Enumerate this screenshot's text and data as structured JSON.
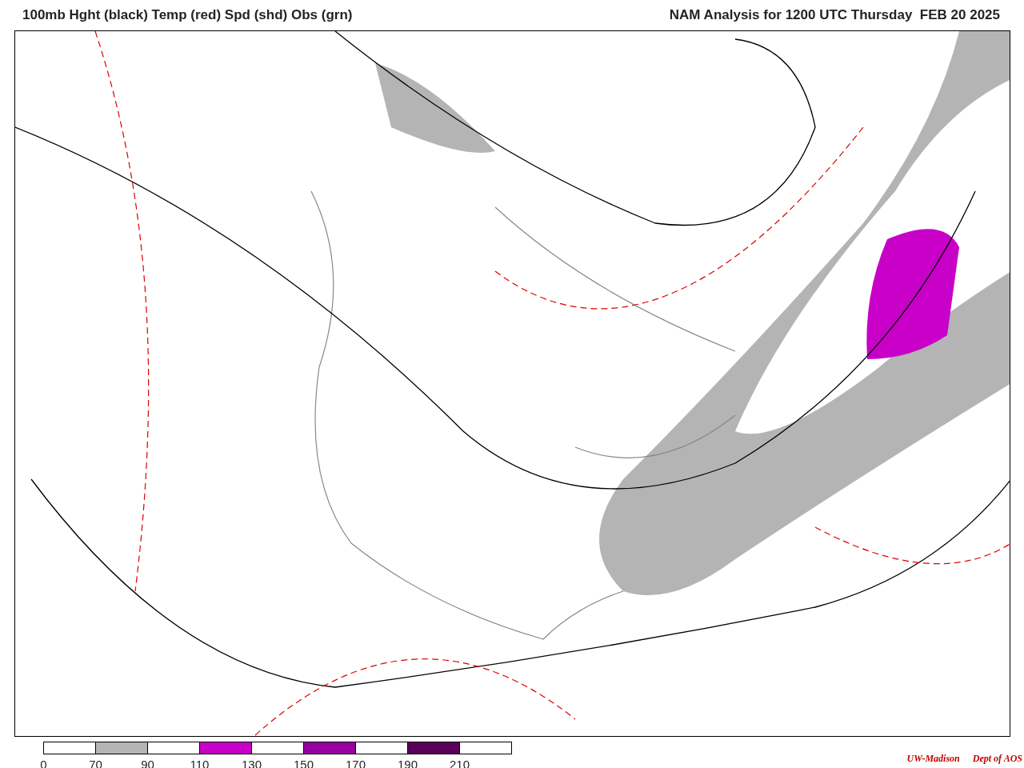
{
  "header": {
    "title": "100mb Hght (black) Temp (red) Spd (shd) Obs (grn)",
    "subtitle": "NAM Analysis for 1200 UTC Thursday  FEB 20 2025"
  },
  "legend": {
    "segments": [
      {
        "color": "#ffffff"
      },
      {
        "color": "#b4b4b4"
      },
      {
        "color": "#ffffff"
      },
      {
        "color": "#c800c8"
      },
      {
        "color": "#ffffff"
      },
      {
        "color": "#9600a0"
      },
      {
        "color": "#ffffff"
      },
      {
        "color": "#5a005a"
      },
      {
        "color": "#ffffff"
      }
    ],
    "labels": [
      "0",
      "70",
      "90",
      "110",
      "130",
      "150",
      "170",
      "190",
      "210"
    ]
  },
  "credit": {
    "org": "UW-Madison",
    "dept": "Dept of AOS"
  }
}
